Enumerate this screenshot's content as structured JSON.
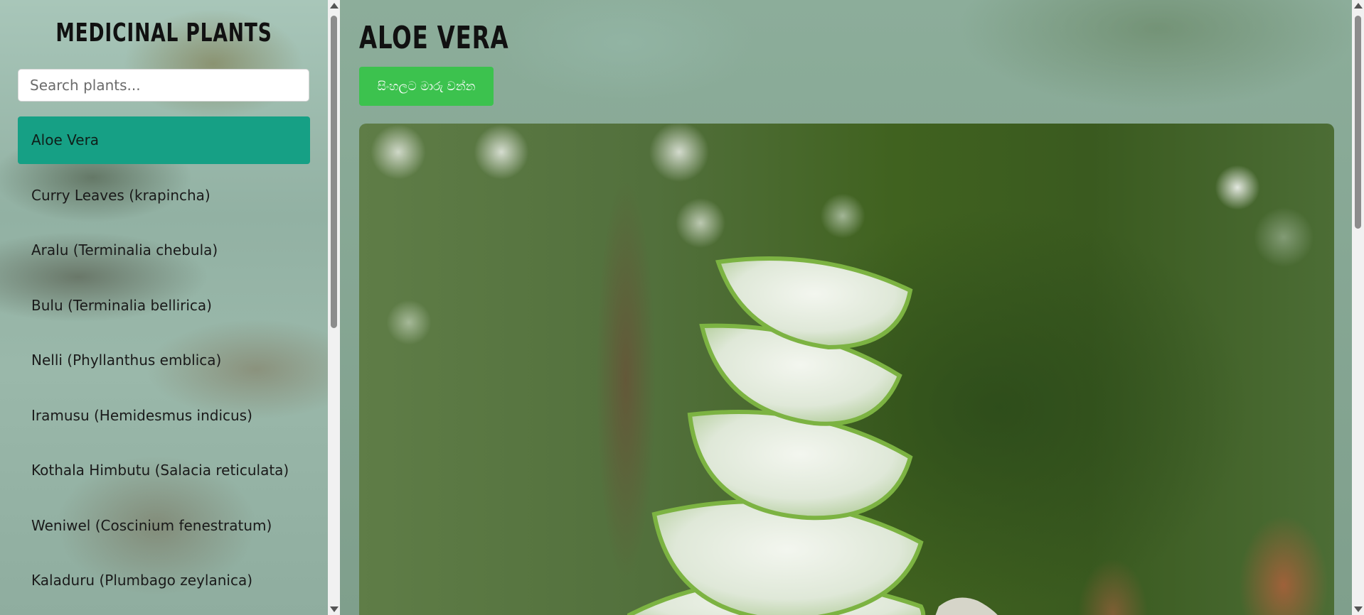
{
  "sidebar": {
    "title": "MEDICINAL PLANTS",
    "search": {
      "placeholder": "Search plants...",
      "value": ""
    },
    "items": [
      {
        "label": "Aloe Vera",
        "active": true
      },
      {
        "label": "Curry Leaves (krapincha)"
      },
      {
        "label": "Aralu (Terminalia chebula)"
      },
      {
        "label": "Bulu (Terminalia bellirica)"
      },
      {
        "label": "Nelli (Phyllanthus emblica)"
      },
      {
        "label": "Iramusu (Hemidesmus indicus)"
      },
      {
        "label": "Kothala Himbutu (Salacia reticulata)"
      },
      {
        "label": "Weniwel (Coscinium fenestratum)"
      },
      {
        "label": "Kaladuru (Plumbago zeylanica)"
      }
    ]
  },
  "main": {
    "title": "ALOE VERA",
    "language_button": "සිංහලට මාරු වන්න",
    "image_subject": "aloe vera leaf slices stacked"
  },
  "colors": {
    "active_item": "#16a085",
    "language_button": "#3cc24e"
  },
  "icons": [
    "scroll-up-arrow-icon",
    "scroll-down-arrow-icon"
  ]
}
